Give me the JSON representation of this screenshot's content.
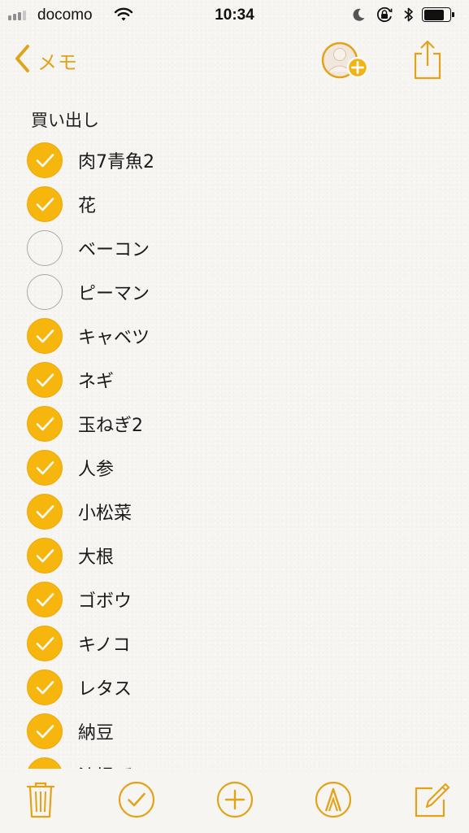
{
  "status_bar": {
    "carrier": "docomo",
    "time": "10:34",
    "battery_level_percent": 80
  },
  "nav": {
    "back_label": "メモ",
    "icons": [
      "chevron-left-icon",
      "add-person-icon",
      "share-icon"
    ]
  },
  "note": {
    "title": "買い出し",
    "items": [
      {
        "label": "肉7青魚2",
        "checked": true
      },
      {
        "label": "花",
        "checked": true
      },
      {
        "label": "ベーコン",
        "checked": false
      },
      {
        "label": "ピーマン",
        "checked": false
      },
      {
        "label": "キャベツ",
        "checked": true
      },
      {
        "label": "ネギ",
        "checked": true
      },
      {
        "label": "玉ねぎ2",
        "checked": true
      },
      {
        "label": "人参",
        "checked": true
      },
      {
        "label": "小松菜",
        "checked": true
      },
      {
        "label": "大根",
        "checked": true
      },
      {
        "label": "ゴボウ",
        "checked": true
      },
      {
        "label": "キノコ",
        "checked": true
      },
      {
        "label": "レタス",
        "checked": true
      },
      {
        "label": "納豆",
        "checked": true
      },
      {
        "label": "油揚げ",
        "checked": true
      }
    ]
  },
  "toolbar": {
    "icons": [
      "trash-icon",
      "checklist-icon",
      "add-icon",
      "markup-icon",
      "compose-icon"
    ]
  },
  "colors": {
    "accent": "#e2a31a",
    "check_fill": "#f6b60e",
    "unchecked_ring": "#a9a9a9"
  }
}
